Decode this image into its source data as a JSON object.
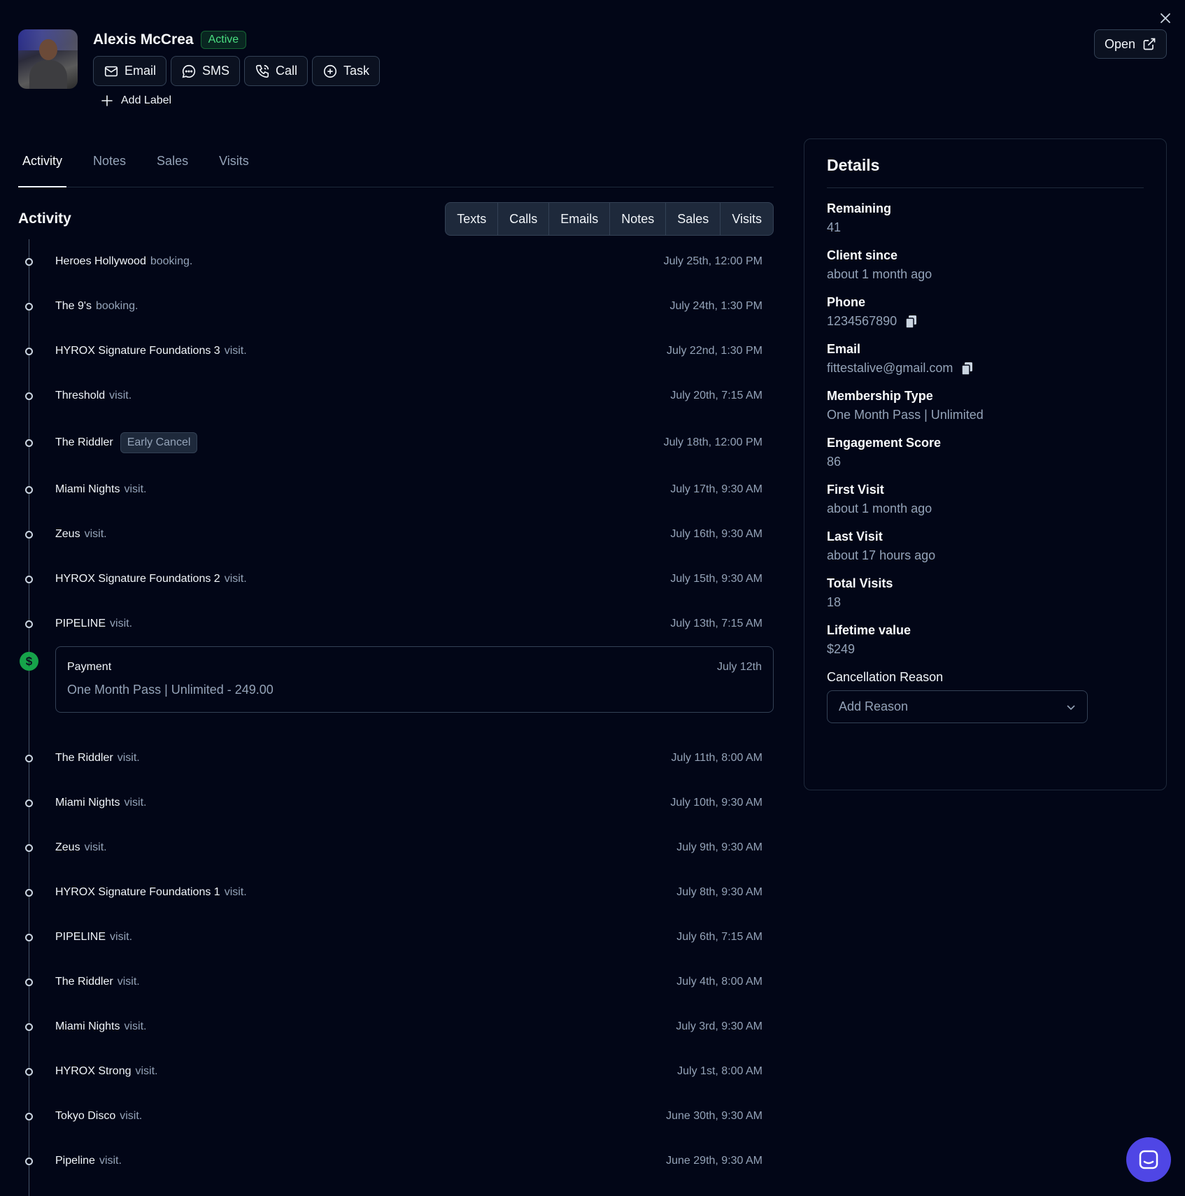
{
  "profile": {
    "name": "Alexis McCrea",
    "status": "Active",
    "add_label": "Add Label"
  },
  "actions": {
    "email": "Email",
    "sms": "SMS",
    "call": "Call",
    "task": "Task",
    "open": "Open"
  },
  "tabs": [
    "Activity",
    "Notes",
    "Sales",
    "Visits"
  ],
  "activity": {
    "title": "Activity",
    "filters": [
      "Texts",
      "Calls",
      "Emails",
      "Notes",
      "Sales",
      "Visits"
    ],
    "items": [
      {
        "name": "Heroes Hollywood",
        "suffix": "booking.",
        "time": "July 25th, 12:00 PM"
      },
      {
        "name": "The 9's",
        "suffix": "booking.",
        "time": "July 24th, 1:30 PM"
      },
      {
        "name": "HYROX Signature Foundations 3",
        "suffix": "visit.",
        "time": "July 22nd, 1:30 PM"
      },
      {
        "name": "Threshold",
        "suffix": "visit.",
        "time": "July 20th, 7:15 AM"
      },
      {
        "name": "The Riddler",
        "tag": "Early Cancel",
        "time": "July 18th, 12:00 PM"
      },
      {
        "name": "Miami Nights",
        "suffix": "visit.",
        "time": "July 17th, 9:30 AM"
      },
      {
        "name": "Zeus",
        "suffix": "visit.",
        "time": "July 16th, 9:30 AM"
      },
      {
        "name": "HYROX Signature Foundations 2",
        "suffix": "visit.",
        "time": "July 15th, 9:30 AM"
      },
      {
        "name": "PIPELINE",
        "suffix": "visit.",
        "time": "July 13th, 7:15 AM"
      }
    ],
    "payment": {
      "title": "Payment",
      "date": "July 12th",
      "description": "One Month Pass | Unlimited - 249.00",
      "icon": "$"
    },
    "items_after": [
      {
        "name": "The Riddler",
        "suffix": "visit.",
        "time": "July 11th, 8:00 AM"
      },
      {
        "name": "Miami Nights",
        "suffix": "visit.",
        "time": "July 10th, 9:30 AM"
      },
      {
        "name": "Zeus",
        "suffix": "visit.",
        "time": "July 9th, 9:30 AM"
      },
      {
        "name": "HYROX Signature Foundations 1",
        "suffix": "visit.",
        "time": "July 8th, 9:30 AM"
      },
      {
        "name": "PIPELINE",
        "suffix": "visit.",
        "time": "July 6th, 7:15 AM"
      },
      {
        "name": "The Riddler",
        "suffix": "visit.",
        "time": "July 4th, 8:00 AM"
      },
      {
        "name": "Miami Nights",
        "suffix": "visit.",
        "time": "July 3rd, 9:30 AM"
      },
      {
        "name": "HYROX Strong",
        "suffix": "visit.",
        "time": "July 1st, 8:00 AM"
      },
      {
        "name": "Tokyo Disco",
        "suffix": "visit.",
        "time": "June 30th, 9:30 AM"
      },
      {
        "name": "Pipeline",
        "suffix": "visit.",
        "time": "June 29th, 9:30 AM"
      }
    ]
  },
  "details": {
    "title": "Details",
    "fields": [
      {
        "label": "Remaining",
        "value": "41"
      },
      {
        "label": "Client since",
        "value": "about 1 month ago"
      },
      {
        "label": "Phone",
        "value": "1234567890",
        "copy": true
      },
      {
        "label": "Email",
        "value": "fittestalive@gmail.com",
        "copy": true
      },
      {
        "label": "Membership Type",
        "value": "One Month Pass | Unlimited"
      },
      {
        "label": "Engagement Score",
        "value": "86"
      },
      {
        "label": "First Visit",
        "value": "about 1 month ago"
      },
      {
        "label": "Last Visit",
        "value": "about 17 hours ago"
      },
      {
        "label": "Total Visits",
        "value": "18"
      },
      {
        "label": "Lifetime value",
        "value": "$249"
      }
    ],
    "cancellation": {
      "label": "Cancellation Reason",
      "placeholder": "Add Reason"
    }
  },
  "colors": {
    "background": "#020617",
    "active_badge": "#4ade80",
    "payment_icon": "#16a34a",
    "chat_button": "#4f46e5"
  }
}
